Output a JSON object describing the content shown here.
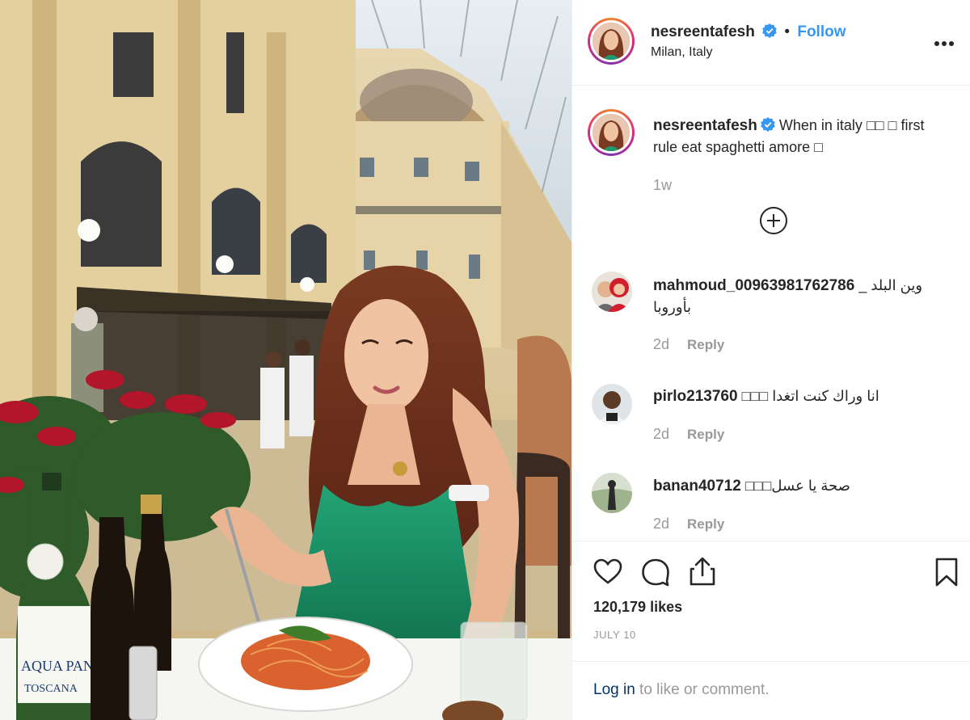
{
  "post": {
    "image_description_icon": "photo",
    "header": {
      "username": "nesreentafesh",
      "verified": true,
      "separator": "•",
      "follow_label": "Follow",
      "location": "Milan, Italy",
      "more_icon": "more-horizontal-icon",
      "more_label": "..."
    },
    "caption": {
      "username": "nesreentafesh",
      "text": "When in italy □□ □ first rule eat spaghetti amore □",
      "time": "1w"
    },
    "load_more_icon": "plus-circle-icon",
    "comments": [
      {
        "username": "mahmoud_00963981762786",
        "text": "وين البلد _ بأوروبا",
        "time": "2d",
        "reply_label": "Reply"
      },
      {
        "username": "pirlo213760",
        "text": "انا وراك كنت اتغدا □□□",
        "time": "2d",
        "reply_label": "Reply"
      },
      {
        "username": "banan40712",
        "text": "صحة يا عسل□□□",
        "time": "2d",
        "reply_label": "Reply"
      }
    ],
    "actions": {
      "like_icon": "heart-icon",
      "comment_icon": "comment-icon",
      "share_icon": "share-icon",
      "save_icon": "bookmark-icon"
    },
    "likes": "120,179 likes",
    "date": "JULY 10",
    "login_prompt": {
      "link": "Log in",
      "rest": " to like or comment."
    }
  },
  "colors": {
    "link": "#3897f0",
    "muted": "#999999",
    "text": "#262626",
    "dress": "#1f9a6e"
  }
}
